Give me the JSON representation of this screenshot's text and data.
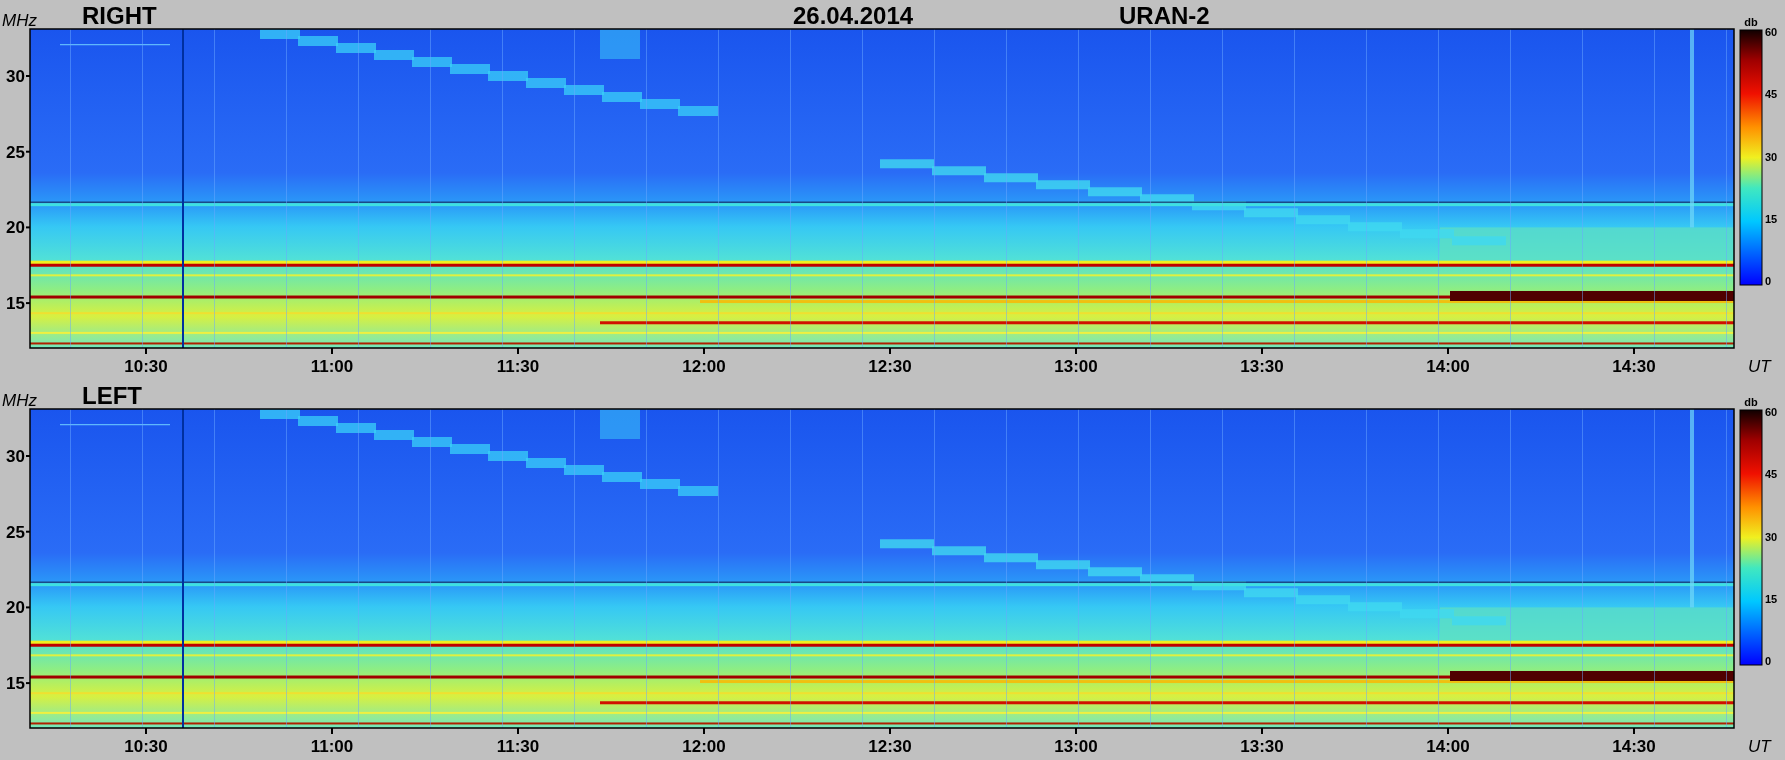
{
  "panels": [
    {
      "label": "RIGHT",
      "date": "26.04.2014",
      "instrument": "URAN-2",
      "y_unit": "MHz",
      "y_ticks": [
        "30",
        "25",
        "20",
        "15"
      ],
      "x_ticks": [
        "10:30",
        "11:00",
        "11:30",
        "12:00",
        "12:30",
        "13:00",
        "13:30",
        "14:00",
        "14:30"
      ],
      "x_unit": "UT",
      "colorbar": {
        "unit": "db",
        "ticks": [
          "60",
          "45",
          "30",
          "15",
          "0"
        ]
      }
    },
    {
      "label": "LEFT",
      "y_unit": "MHz",
      "y_ticks": [
        "30",
        "25",
        "20",
        "15"
      ],
      "x_ticks": [
        "10:30",
        "11:00",
        "11:30",
        "12:00",
        "12:30",
        "13:00",
        "13:30",
        "14:00",
        "14:30"
      ],
      "x_unit": "UT",
      "colorbar": {
        "unit": "db",
        "ticks": [
          "60",
          "45",
          "30",
          "15",
          "0"
        ]
      }
    }
  ]
}
